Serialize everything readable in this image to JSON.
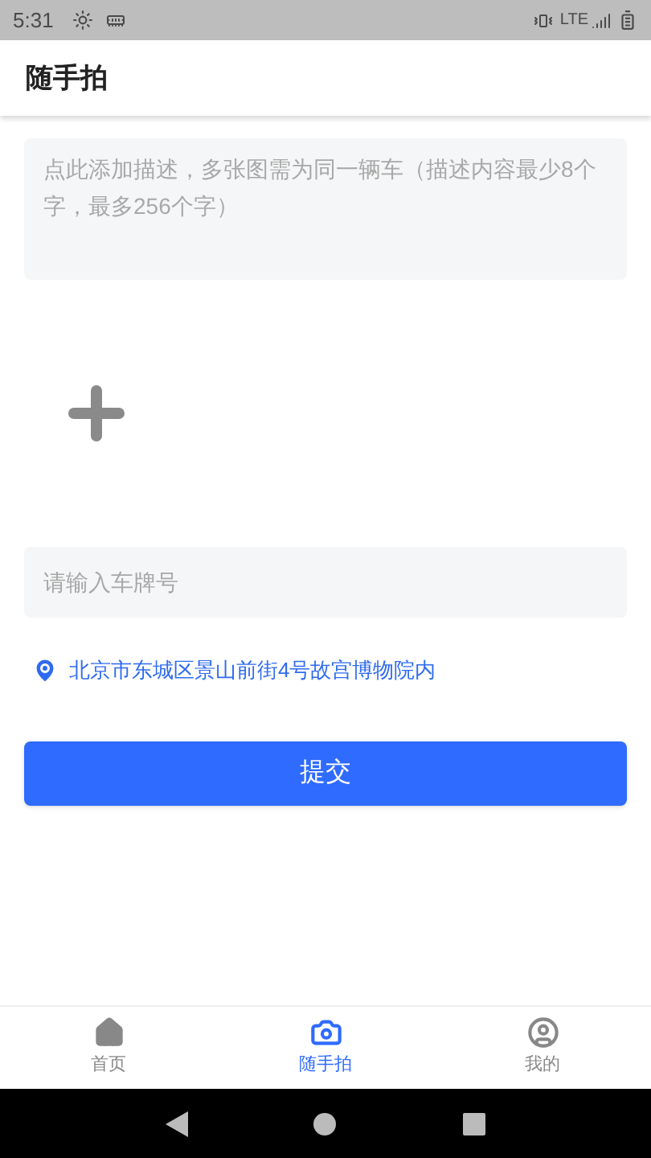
{
  "status_bar": {
    "time": "5:31",
    "network": "LTE"
  },
  "app_bar": {
    "title": "随手拍"
  },
  "description": {
    "placeholder": "点此添加描述，多张图需为同一辆车（描述内容最少8个字，最多256个字）"
  },
  "plate": {
    "placeholder": "请输入车牌号"
  },
  "location": {
    "address": "北京市东城区景山前街4号故宫博物院内"
  },
  "submit": {
    "label": "提交"
  },
  "tabs": [
    {
      "kind": "home",
      "label": "首页",
      "selected": false
    },
    {
      "kind": "camera",
      "label": "随手拍",
      "selected": true
    },
    {
      "kind": "profile",
      "label": "我的",
      "selected": false
    }
  ]
}
